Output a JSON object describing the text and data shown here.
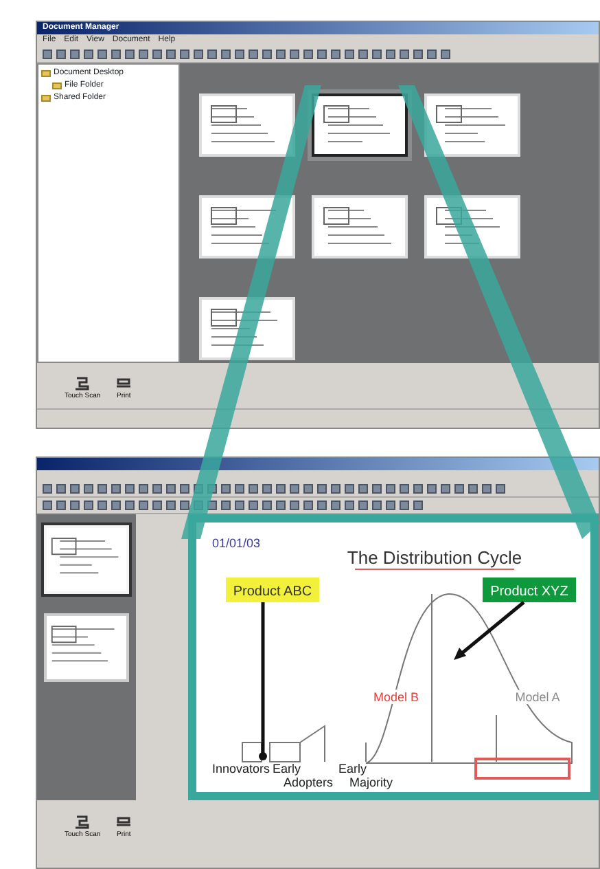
{
  "top_window": {
    "title": "Document Manager",
    "menu": [
      "File",
      "Edit",
      "View",
      "Document",
      "Help"
    ],
    "tree": [
      {
        "label": "Document Desktop",
        "children": [
          {
            "label": "File Folder"
          }
        ]
      },
      {
        "label": "Shared Folder"
      }
    ],
    "thumbnails": [
      {
        "selected": false
      },
      {
        "selected": true
      },
      {
        "selected": false
      },
      {
        "selected": false
      },
      {
        "selected": false
      },
      {
        "selected": false
      },
      {
        "selected": false
      }
    ],
    "bottom_buttons": [
      "Touch Scan",
      "Print"
    ]
  },
  "bottom_window": {
    "page_thumbnails": [
      {
        "selected": true
      },
      {
        "selected": false
      }
    ],
    "page": {
      "date": "01/01/03",
      "title": "The Distribution Cycle",
      "tags": [
        {
          "text": "Product ABC",
          "color": "#f2f03a"
        },
        {
          "text": "Product XYZ",
          "color": "#0e9a3c"
        }
      ],
      "models": [
        {
          "text": "Model B",
          "color": "#e8403a"
        },
        {
          "text": "Model A",
          "color": "#8a8a8a"
        }
      ],
      "stages": [
        "Innovators",
        "Early Adopters",
        "Early Majority"
      ]
    },
    "bottom_buttons": [
      "Touch Scan",
      "Print"
    ]
  }
}
